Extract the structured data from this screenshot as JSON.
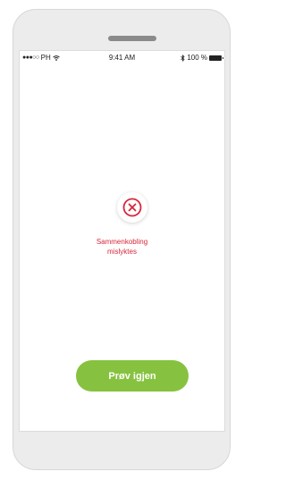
{
  "status_bar": {
    "carrier": "PH",
    "time": "9:41 AM",
    "battery": "100 %"
  },
  "error": {
    "icon": "close-icon",
    "message_line1": "Sammenkobling",
    "message_line2": "mislyktes",
    "color": "#d8263a"
  },
  "retry_button": {
    "label": "Prøv igjen",
    "color": "#86c23f"
  }
}
